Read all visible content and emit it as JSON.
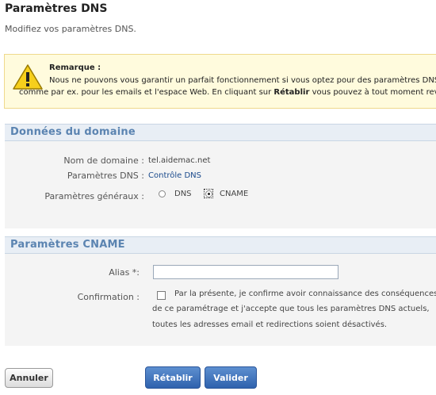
{
  "header": {
    "title": "Paramètres DNS",
    "subtitle": "Modifiez vos paramètres DNS."
  },
  "notice": {
    "icon": "warning-icon",
    "title": "Remarque :",
    "line1": "Nous ne pouvons vous garantir un parfait fonctionnement si vous optez pour des paramètres DNS au",
    "line2_before": "comme par ex. pour les emails et l'espace Web. En cliquant sur ",
    "line2_bold": "Rétablir",
    "line2_after": " vous pouvez à tout moment reveni"
  },
  "domain_section": {
    "title": "Données du domaine",
    "domain_label": "Nom de domaine :",
    "domain_value": "tel.aidemac.net",
    "dns_label": "Paramètres DNS :",
    "dns_value": "Contrôle DNS",
    "general_label": "Paramètres généraux :",
    "options": [
      "DNS",
      "CNAME"
    ],
    "selected_option": "CNAME"
  },
  "cname_section": {
    "title": "Paramètres CNAME",
    "alias_label": "Alias *:",
    "alias_value": "",
    "confirm_label": "Confirmation :",
    "confirm_lines": [
      "Par la présente, je confirme avoir connaissance des conséquences",
      "de ce paramétrage et j'accepte que tous les paramètres DNS actuels,",
      "toutes les adresses email et redirections soient désactivés."
    ],
    "confirm_checked": false
  },
  "buttons": {
    "cancel": "Annuler",
    "reset": "Rétablir",
    "validate": "Valider"
  },
  "colors": {
    "section_title": "#5b84b1",
    "primary_button": "#3b6fbd",
    "notice_bg": "#fffbdd"
  }
}
